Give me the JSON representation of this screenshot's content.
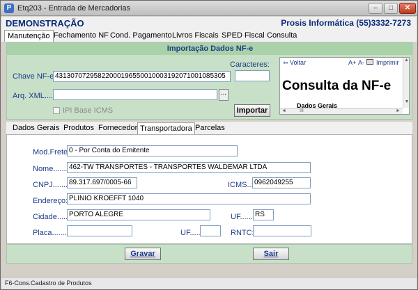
{
  "window": {
    "title": "Etq203 - Entrada de Mercadorias",
    "icon_letter": "P",
    "buttons": {
      "minimize": "–",
      "maximize": "□",
      "close": "✕"
    }
  },
  "header": {
    "left": "DEMONSTRAÇÃO",
    "right": "Prosis Informática (55)3332-7273"
  },
  "tabs": [
    {
      "label": "Manutenção",
      "active": true
    },
    {
      "label": "Fechamento NF"
    },
    {
      "label": "Cond. Pagamento"
    },
    {
      "label": "Livros Fiscais"
    },
    {
      "label": "SPED Fiscal"
    },
    {
      "label": "Consulta"
    }
  ],
  "import_panel": {
    "header": "Importação Dados NF-e",
    "chave_label": "Chave NF-e:",
    "chave_value": "43130707295822000196550010003192071001085305",
    "caracteres_label": "Caracteres:",
    "caracteres_value": "",
    "arq_label": "Arq. XML.......:",
    "arq_value": "",
    "browse_label": "...",
    "ipi_label": "IPI Base ICMS",
    "importar_label": "Importar"
  },
  "browser": {
    "back_label": "Voltar",
    "aplus": "A+",
    "aminus": "A-",
    "print_label": "Imprimir",
    "title": "Consulta da NF-e",
    "subtitle": "Dados Gerais",
    "hscroll_thumb": "III",
    "vscroll_up": "▲",
    "vscroll_down": "▼",
    "hscroll_left": "◄",
    "hscroll_right": "►"
  },
  "subtabs": [
    {
      "label": "Dados Gerais"
    },
    {
      "label": "Produtos"
    },
    {
      "label": "Fornecedor"
    },
    {
      "label": "Transportadora",
      "active": true
    },
    {
      "label": "Parcelas"
    }
  ],
  "form": {
    "mod_frete_label": "Mod.Frete:",
    "mod_frete_value": "0 - Por Conta do Emitente",
    "nome_label": "Nome.........:",
    "nome_value": "462-TW TRANSPORTES - TRANSPORTES WALDEMAR LTDA",
    "cnpj_label": "CNPJ.........:",
    "cnpj_value": "89.317.697/0005-66",
    "icms_label": "ICMS..:",
    "icms_value": "0962049255",
    "endereco_label": "Endereço:",
    "endereco_value": "PLINIO KROEFFT 1040",
    "cidade_label": "Cidade......:",
    "cidade_value": "PORTO ALEGRE",
    "uf_label": "UF........:",
    "uf_value": "RS",
    "placa_label": "Placa.......:",
    "placa_value": "",
    "uf2_label": "UF.....:",
    "uf2_value": "",
    "rntc_label": "RNTC:",
    "rntc_value": ""
  },
  "actions": {
    "gravar": "Gravar",
    "sair": "Sair"
  },
  "statusbar": {
    "text": "F6-Cons.Cadastro de Produtos"
  }
}
